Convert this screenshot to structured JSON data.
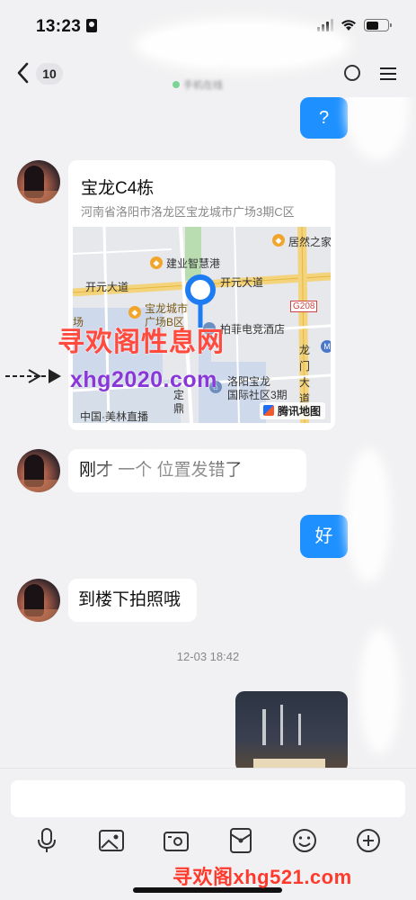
{
  "status_bar": {
    "time": "13:23"
  },
  "nav": {
    "unread_count": "10",
    "title": "···",
    "subtitle": "手机在线"
  },
  "messages": {
    "outgoing_question": "?",
    "location": {
      "title": "宝龙C4栋",
      "address": "河南省洛阳市洛龙区宝龙城市广场3期C区",
      "map_labels": {
        "jushi": "居然之家",
        "jianye": "建业智慧港",
        "kaiyuan_left": "开元大道",
        "kaiyuan_right": "开元大道",
        "g208": "G208",
        "baolong_city": "宝龙城市",
        "baolong_city_2": "广场B区",
        "bofei": "柏菲电竞酒店",
        "chang": "场",
        "longmen_1": "龙",
        "longmen_2": "门",
        "longmen_3": "大",
        "longmen_4": "道",
        "luoyang_baolong_1": "洛阳宝龙",
        "luoyang_baolong_2": "国际社区3期",
        "ding_1": "定",
        "ding_2": "鼎",
        "zhongguo": "中国·美林直播"
      },
      "attribution": "腾讯地图"
    },
    "incoming_position_wrong": "刚才 一个 位置发错了",
    "outgoing_ok": "好",
    "incoming_photo_request": "到楼下拍照哦",
    "timestamp": "12-03 18:42"
  },
  "watermarks": {
    "line1": "寻欢阁性息网",
    "line2": "xhg2020.com",
    "bottom": "寻欢阁xhg521.com"
  },
  "input": {
    "placeholder": ""
  },
  "icons": {
    "back": "chevron-left-icon",
    "menu": "menu-icon",
    "mic": "microphone-icon",
    "image": "image-icon",
    "camera": "camera-icon",
    "red_packet": "red-packet-icon",
    "emoji": "emoji-icon",
    "plus": "plus-icon"
  },
  "colors": {
    "accent": "#1e90ff",
    "background": "#f1f1f3",
    "online": "#2fc25b"
  }
}
